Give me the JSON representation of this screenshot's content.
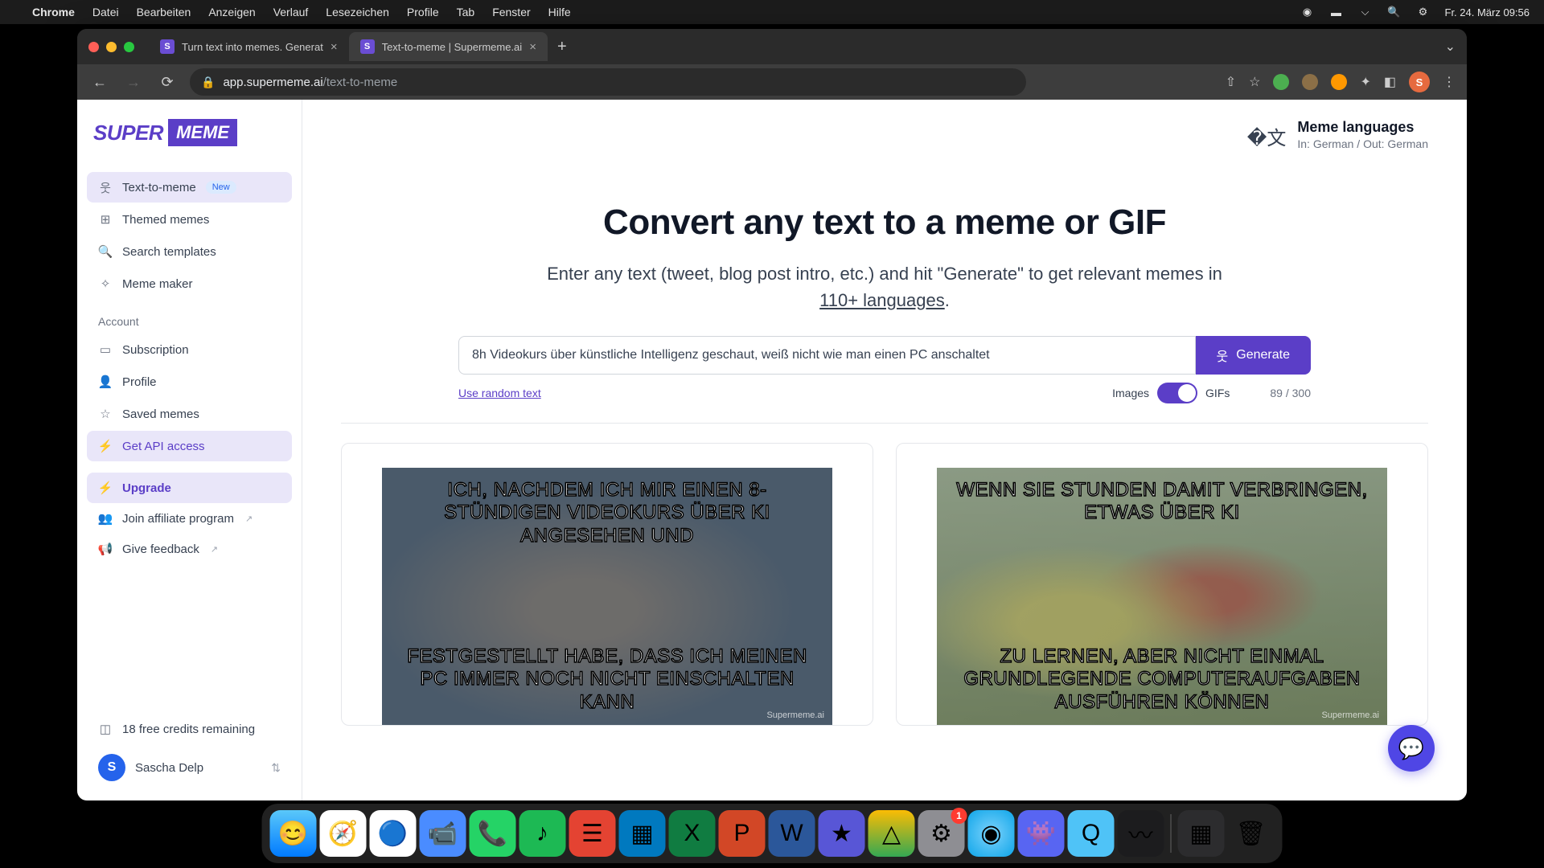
{
  "menubar": {
    "app": "Chrome",
    "items": [
      "Datei",
      "Bearbeiten",
      "Anzeigen",
      "Verlauf",
      "Lesezeichen",
      "Profile",
      "Tab",
      "Fenster",
      "Hilfe"
    ],
    "datetime": "Fr. 24. März  09:56"
  },
  "tabs": {
    "t1": "Turn text into memes. Generat",
    "t2": "Text-to-meme | Supermeme.ai"
  },
  "url": {
    "host": "app.supermeme.ai",
    "path": "/text-to-meme"
  },
  "logo": {
    "a": "SUPER",
    "b": "MEME"
  },
  "nav": {
    "text_to_meme": "Text-to-meme",
    "new_badge": "New",
    "themed": "Themed memes",
    "search": "Search templates",
    "maker": "Meme maker",
    "account_label": "Account",
    "subscription": "Subscription",
    "profile": "Profile",
    "saved": "Saved memes",
    "api": "Get API access",
    "upgrade": "Upgrade",
    "affiliate": "Join affiliate program",
    "feedback": "Give feedback",
    "credits": "18 free credits remaining"
  },
  "user": {
    "initial": "S",
    "name": "Sascha Delp"
  },
  "lang": {
    "title": "Meme languages",
    "sub": "In: German / Out: German"
  },
  "hero": {
    "title": "Convert any text to a meme or GIF",
    "sub_a": "Enter any text (tweet, blog post intro, etc.) and hit \"Generate\" to get relevant memes in ",
    "sub_b": "110+ languages",
    "sub_c": "."
  },
  "input": {
    "value": "8h Videokurs über künstliche Intelligenz geschaut, weiß nicht wie man einen PC anschaltet",
    "generate": "Generate",
    "random": "Use random text",
    "images": "Images",
    "gifs": "GIFs",
    "counter": "89 / 300"
  },
  "memes": {
    "m1_top": "ICH, NACHDEM ICH MIR EINEN 8-STÜNDIGEN VIDEOKURS ÜBER KI ANGESEHEN UND",
    "m1_bottom": "FESTGESTELLT HABE, DASS ICH MEINEN PC IMMER NOCH NICHT EINSCHALTEN KANN",
    "m2_top": "WENN SIE STUNDEN DAMIT VERBRINGEN, ETWAS ÜBER KI",
    "m2_bottom": "ZU LERNEN, ABER NICHT EINMAL GRUNDLEGENDE COMPUTERAUFGABEN AUSFÜHREN KÖNNEN",
    "watermark": "Supermeme.ai"
  },
  "dock": {
    "badge": "1"
  },
  "avatar_initial": "S"
}
